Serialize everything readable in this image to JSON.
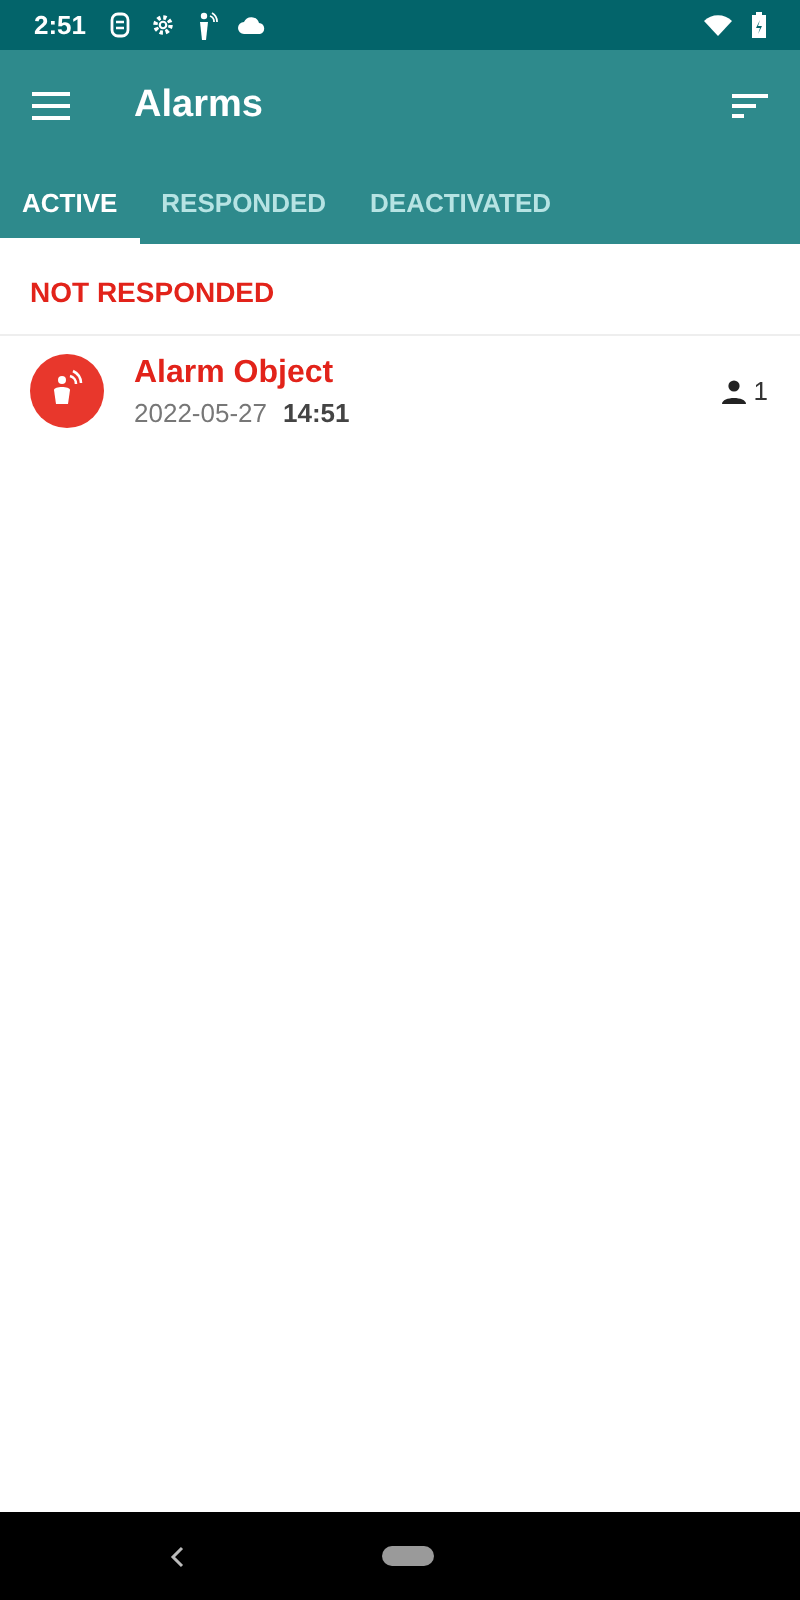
{
  "status_bar": {
    "time": "2:51"
  },
  "app_bar": {
    "title": "Alarms"
  },
  "tabs": [
    {
      "label": "ACTIVE",
      "selected": true
    },
    {
      "label": "RESPONDED",
      "selected": false
    },
    {
      "label": "DEACTIVATED",
      "selected": false
    }
  ],
  "sections": [
    {
      "title": "NOT RESPONDED",
      "alarms": [
        {
          "name": "Alarm Object",
          "date": "2022-05-27",
          "time": "14:51",
          "responders": "1"
        }
      ]
    }
  ]
}
